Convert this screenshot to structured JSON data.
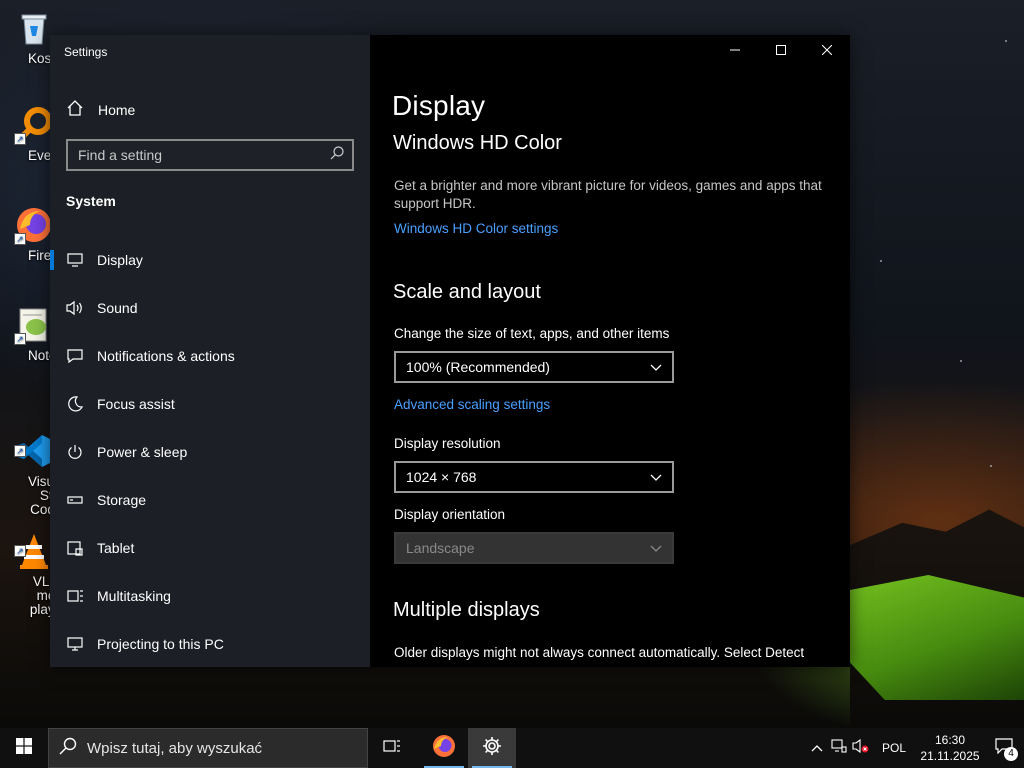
{
  "desktop": {
    "icons": [
      {
        "label": "Kosz"
      },
      {
        "label": "Everyth"
      },
      {
        "label": "Firefc"
      },
      {
        "label": "Notepac"
      },
      {
        "label": "Visual St\nCode"
      },
      {
        "label": "VLC me\nplaye"
      }
    ]
  },
  "window": {
    "app_title": "Settings",
    "caption": {
      "minimize": "minimize",
      "maximize": "maximize",
      "close": "close"
    }
  },
  "sidebar": {
    "home_label": "Home",
    "search_placeholder": "Find a setting",
    "section_title": "System",
    "items": [
      {
        "label": "Display",
        "icon": "monitor-icon",
        "active": true
      },
      {
        "label": "Sound",
        "icon": "speaker-icon"
      },
      {
        "label": "Notifications & actions",
        "icon": "notification-icon"
      },
      {
        "label": "Focus assist",
        "icon": "moon-icon"
      },
      {
        "label": "Power & sleep",
        "icon": "power-icon"
      },
      {
        "label": "Storage",
        "icon": "storage-icon"
      },
      {
        "label": "Tablet",
        "icon": "tablet-icon"
      },
      {
        "label": "Multitasking",
        "icon": "multitasking-icon"
      },
      {
        "label": "Projecting to this PC",
        "icon": "projecting-icon"
      }
    ]
  },
  "main": {
    "page_title": "Display",
    "hd_color": {
      "heading": "Windows HD Color",
      "description": "Get a brighter and more vibrant picture for videos, games and apps that support HDR.",
      "link": "Windows HD Color settings"
    },
    "scale_layout": {
      "heading": "Scale and layout",
      "size_label": "Change the size of text, apps, and other items",
      "size_value": "100% (Recommended)",
      "advanced_link": "Advanced scaling settings",
      "resolution_label": "Display resolution",
      "resolution_value": "1024 × 768",
      "orientation_label": "Display orientation",
      "orientation_value": "Landscape"
    },
    "multiple_displays": {
      "heading": "Multiple displays",
      "description": "Older displays might not always connect automatically. Select Detect"
    }
  },
  "taskbar": {
    "search_placeholder": "Wpisz tutaj, aby wyszukać",
    "language": "POL",
    "time": "16:30",
    "date": "21.11.2025",
    "notification_count": "4"
  },
  "colors": {
    "accent": "#0078d7",
    "link": "#4aa0ff"
  }
}
